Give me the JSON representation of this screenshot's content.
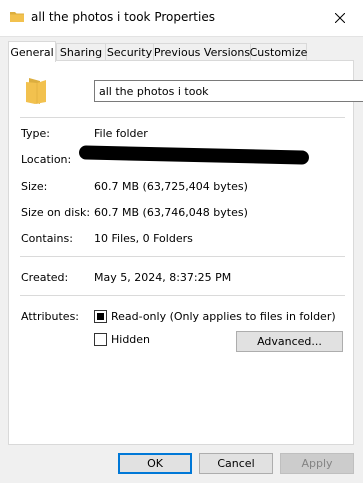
{
  "window": {
    "title": "all the photos i took Properties",
    "close_glyph": "✕"
  },
  "tabs": [
    {
      "label": "General"
    },
    {
      "label": "Sharing"
    },
    {
      "label": "Security"
    },
    {
      "label": "Previous Versions"
    },
    {
      "label": "Customize"
    }
  ],
  "general": {
    "name_value": "all the photos i took",
    "type_label": "Type:",
    "type_value": "File folder",
    "location_label": "Location:",
    "size_label": "Size:",
    "size_value": "60.7 MB (63,725,404 bytes)",
    "size_on_disk_label": "Size on disk:",
    "size_on_disk_value": "60.7 MB (63,746,048 bytes)",
    "contains_label": "Contains:",
    "contains_value": "10 Files, 0 Folders",
    "created_label": "Created:",
    "created_value": "May 5, 2024, 8:37:25 PM",
    "attributes_label": "Attributes:",
    "readonly_label": "Read-only (Only applies to files in folder)",
    "readonly_state": "mixed",
    "hidden_label": "Hidden",
    "hidden_state": "unchecked",
    "advanced_label": "Advanced..."
  },
  "footer": {
    "ok_label": "OK",
    "cancel_label": "Cancel",
    "apply_label": "Apply"
  },
  "colors": {
    "folder": "#f2c14e",
    "accent": "#0078d7",
    "redaction": "#000000"
  },
  "icons": {
    "title": "folder-icon",
    "main": "folder-icon",
    "close": "close-icon"
  }
}
